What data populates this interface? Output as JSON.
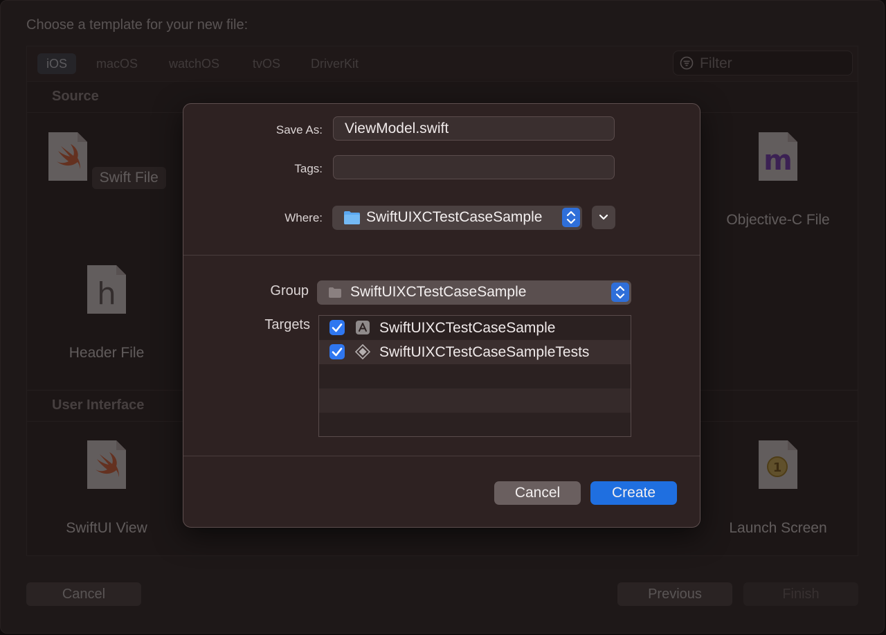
{
  "window": {
    "title": "Choose a template for your new file:",
    "platform_tabs": [
      {
        "label": "iOS",
        "selected": true
      },
      {
        "label": "macOS",
        "selected": false
      },
      {
        "label": "watchOS",
        "selected": false
      },
      {
        "label": "tvOS",
        "selected": false
      },
      {
        "label": "DriverKit",
        "selected": false
      }
    ],
    "filter": {
      "placeholder": "Filter",
      "value": ""
    },
    "sections": [
      {
        "title": "Source"
      },
      {
        "title": "User Interface"
      }
    ],
    "templates": {
      "swift_file": {
        "label": "Swift File",
        "selected": true,
        "glyph": "swift-bird"
      },
      "objc_file": {
        "label": "Objective-C File",
        "glyph": "m"
      },
      "header_file": {
        "label": "Header File",
        "glyph": "h"
      },
      "swiftui_view": {
        "label": "SwiftUI View",
        "glyph": "swift-bird"
      },
      "launch_screen": {
        "label": "Launch Screen",
        "glyph": "1"
      }
    },
    "buttons": {
      "cancel": "Cancel",
      "previous": "Previous",
      "finish": "Finish"
    }
  },
  "sheet": {
    "save_as": {
      "label": "Save As:",
      "value": "ViewModel.swift"
    },
    "tags": {
      "label": "Tags:",
      "value": ""
    },
    "where": {
      "label": "Where:",
      "value": "SwiftUIXCTestCaseSample"
    },
    "group": {
      "label": "Group",
      "value": "SwiftUIXCTestCaseSample"
    },
    "targets": {
      "label": "Targets",
      "rows": [
        {
          "label": "SwiftUIXCTestCaseSample",
          "checked": true,
          "icon": "app-target-icon"
        },
        {
          "label": "SwiftUIXCTestCaseSampleTests",
          "checked": true,
          "icon": "test-target-icon"
        }
      ]
    },
    "buttons": {
      "cancel": "Cancel",
      "create": "Create"
    }
  },
  "colors": {
    "accent": "#2f77f0",
    "primary_button": "#1f6fe0",
    "sheet_background": "#2e2222",
    "window_background": "#2a2323",
    "folder_icon": "#5aa8f0"
  }
}
